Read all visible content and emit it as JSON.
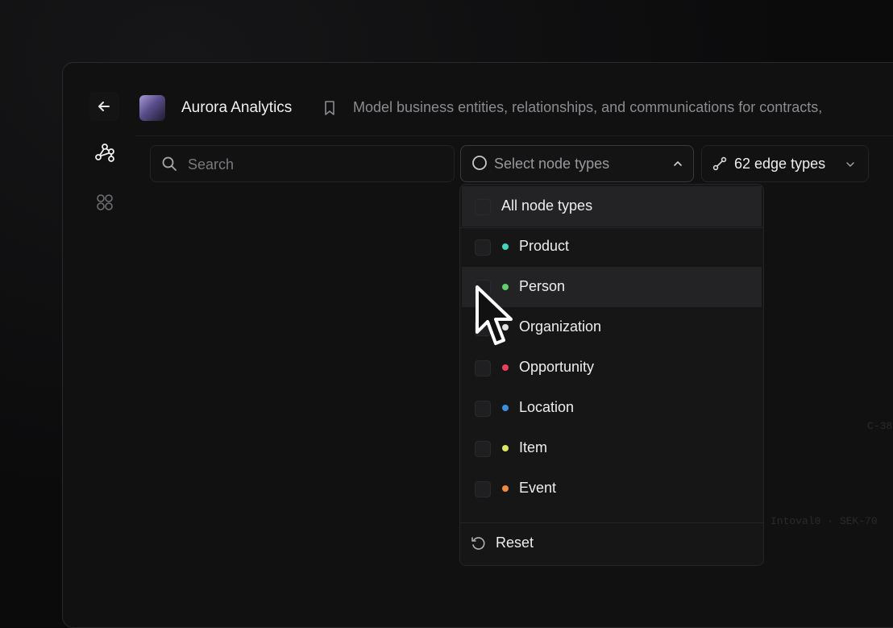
{
  "app": {
    "name": "Aurora Analytics",
    "description": "Model business entities, relationships, and communications for contracts,"
  },
  "toolbar": {
    "search_placeholder": "Search",
    "node_types_placeholder": "Select node types",
    "edge_types_label": "62 edge types"
  },
  "dropdown": {
    "all_label": "All node types",
    "items": [
      {
        "label": "Product",
        "color": "#3fd6c0"
      },
      {
        "label": "Person",
        "color": "#5fd06a"
      },
      {
        "label": "Organization",
        "color": "#e0e0e0"
      },
      {
        "label": "Opportunity",
        "color": "#e8415d"
      },
      {
        "label": "Location",
        "color": "#3b8fe0"
      },
      {
        "label": "Item",
        "color": "#d9e860"
      },
      {
        "label": "Event",
        "color": "#f08a3e"
      }
    ],
    "reset_label": "Reset"
  },
  "background": {
    "faint_1": "C-38",
    "faint_2": "Intoval0 · SEK-70"
  },
  "icons": {
    "back": "arrow-left-icon",
    "bookmark": "bookmark-icon",
    "graph": "graph-icon",
    "apps": "grid-icon",
    "search": "search-icon",
    "node_select": "circle-icon",
    "edge_select": "link-icon",
    "reset": "reset-icon",
    "cursor": "mouse-cursor"
  }
}
